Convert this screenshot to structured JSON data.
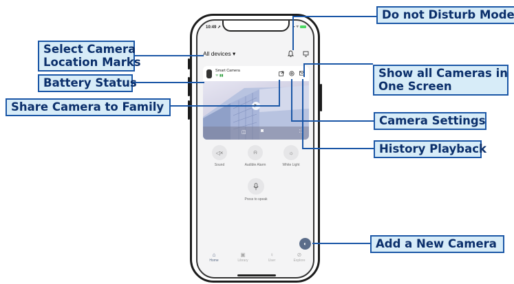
{
  "callouts": {
    "do_not_disturb": "Do not Disturb Mode",
    "select_location_line1": "Select Camera",
    "select_location_line2": "Location Marks",
    "battery_status": "Battery Status",
    "share_camera": "Share Camera to Family",
    "show_all_line1": "Show all Cameras in",
    "show_all_line2": "One Screen",
    "camera_settings": "Camera Settings",
    "history_playback": "History Playback",
    "add_camera": "Add a New Camera"
  },
  "status_bar": {
    "time": "10:49 ➚"
  },
  "header": {
    "title": "All devices ▾"
  },
  "camera": {
    "name": "Smart Camera",
    "status": "ᯤ ▮▮"
  },
  "controls": [
    {
      "label": "Sound",
      "icon": "mute-icon"
    },
    {
      "label": "Audible Alarm",
      "icon": "alarm-icon"
    },
    {
      "label": "White Light",
      "icon": "light-icon"
    }
  ],
  "speak": {
    "label": "Press to speak",
    "icon": "microphone-icon"
  },
  "tabs": [
    {
      "label": "Home",
      "icon": "home-icon"
    },
    {
      "label": "Library",
      "icon": "library-icon"
    },
    {
      "label": "User",
      "icon": "user-icon"
    },
    {
      "label": "Explore",
      "icon": "explore-icon"
    }
  ],
  "colors": {
    "callout_border": "#1a56a6",
    "callout_fill": "#d7ecf8",
    "accent": "#5b6d8a"
  }
}
